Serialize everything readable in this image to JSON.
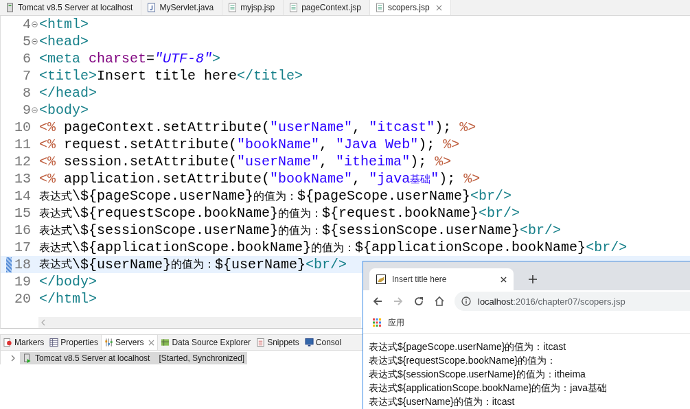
{
  "editor_tabs": [
    {
      "label": "Tomcat v8.5 Server at localhost",
      "kind": "server",
      "selected": false
    },
    {
      "label": "MyServlet.java",
      "kind": "java",
      "selected": false
    },
    {
      "label": "myjsp.jsp",
      "kind": "jsp",
      "selected": false
    },
    {
      "label": "pageContext.jsp",
      "kind": "jsp",
      "selected": false
    },
    {
      "label": "scopers.jsp",
      "kind": "jsp",
      "selected": true
    }
  ],
  "code_lines": [
    {
      "number": "4",
      "folding": true,
      "current": false,
      "tokens": [
        {
          "text": "<html>",
          "kind": "tag"
        }
      ]
    },
    {
      "number": "5",
      "folding": true,
      "current": false,
      "tokens": [
        {
          "text": "<head>",
          "kind": "tag"
        }
      ]
    },
    {
      "number": "6",
      "folding": false,
      "current": false,
      "tokens": [
        {
          "text": "<meta",
          "kind": "tag"
        },
        {
          "text": " charset",
          "kind": "attr"
        },
        {
          "text": "=",
          "kind": "plain"
        },
        {
          "text": "\"UTF-8\"",
          "kind": "value"
        },
        {
          "text": ">",
          "kind": "tag"
        }
      ]
    },
    {
      "number": "7",
      "folding": false,
      "current": false,
      "tokens": [
        {
          "text": "<title>",
          "kind": "tag"
        },
        {
          "text": "Insert title here",
          "kind": "plain"
        },
        {
          "text": "</title>",
          "kind": "tag"
        }
      ]
    },
    {
      "number": "8",
      "folding": false,
      "current": false,
      "tokens": [
        {
          "text": "</head>",
          "kind": "tag"
        }
      ]
    },
    {
      "number": "9",
      "folding": true,
      "current": false,
      "tokens": [
        {
          "text": "<body>",
          "kind": "tag"
        }
      ]
    },
    {
      "number": "10",
      "folding": false,
      "current": false,
      "tokens": [
        {
          "text": "<%",
          "kind": "delim"
        },
        {
          "text": " pageContext.setAttribute(",
          "kind": "plain"
        },
        {
          "text": "\"userName\"",
          "kind": "string"
        },
        {
          "text": ", ",
          "kind": "plain"
        },
        {
          "text": "\"itcast\"",
          "kind": "string"
        },
        {
          "text": "); ",
          "kind": "plain"
        },
        {
          "text": "%>",
          "kind": "delim"
        }
      ]
    },
    {
      "number": "11",
      "folding": false,
      "current": false,
      "tokens": [
        {
          "text": "<%",
          "kind": "delim"
        },
        {
          "text": " request.setAttribute(",
          "kind": "plain"
        },
        {
          "text": "\"bookName\"",
          "kind": "string"
        },
        {
          "text": ", ",
          "kind": "plain"
        },
        {
          "text": "\"Java Web\"",
          "kind": "string"
        },
        {
          "text": "); ",
          "kind": "plain"
        },
        {
          "text": "%>",
          "kind": "delim"
        }
      ]
    },
    {
      "number": "12",
      "folding": false,
      "current": false,
      "tokens": [
        {
          "text": "<%",
          "kind": "delim"
        },
        {
          "text": " session.setAttribute(",
          "kind": "plain"
        },
        {
          "text": "\"userName\"",
          "kind": "string"
        },
        {
          "text": ", ",
          "kind": "plain"
        },
        {
          "text": "\"itheima\"",
          "kind": "string"
        },
        {
          "text": "); ",
          "kind": "plain"
        },
        {
          "text": "%>",
          "kind": "delim"
        }
      ]
    },
    {
      "number": "13",
      "folding": false,
      "current": false,
      "tokens": [
        {
          "text": "<%",
          "kind": "delim"
        },
        {
          "text": " application.setAttribute(",
          "kind": "plain"
        },
        {
          "text": "\"bookName\"",
          "kind": "string"
        },
        {
          "text": ", ",
          "kind": "plain"
        },
        {
          "text": "\"java",
          "kind": "string"
        },
        {
          "text": "基础",
          "kind": "cjkstring"
        },
        {
          "text": "\"",
          "kind": "string"
        },
        {
          "text": "); ",
          "kind": "plain"
        },
        {
          "text": "%>",
          "kind": "delim"
        }
      ]
    },
    {
      "number": "14",
      "folding": false,
      "current": false,
      "tokens": [
        {
          "text": "表达式",
          "kind": "cjk"
        },
        {
          "text": "\\${pageScope.userName}",
          "kind": "plain"
        },
        {
          "text": "的值为：",
          "kind": "cjk"
        },
        {
          "text": "${pageScope.userName}",
          "kind": "plain"
        },
        {
          "text": "<br/>",
          "kind": "tag"
        }
      ]
    },
    {
      "number": "15",
      "folding": false,
      "current": false,
      "tokens": [
        {
          "text": "表达式",
          "kind": "cjk"
        },
        {
          "text": "\\${requestScope.bookName}",
          "kind": "plain"
        },
        {
          "text": "的值为：",
          "kind": "cjk"
        },
        {
          "text": "${request.bookName}",
          "kind": "plain"
        },
        {
          "text": "<br/>",
          "kind": "tag"
        }
      ]
    },
    {
      "number": "16",
      "folding": false,
      "current": false,
      "tokens": [
        {
          "text": "表达式",
          "kind": "cjk"
        },
        {
          "text": "\\${sessionScope.userName}",
          "kind": "plain"
        },
        {
          "text": "的值为：",
          "kind": "cjk"
        },
        {
          "text": "${sessionScope.userName}",
          "kind": "plain"
        },
        {
          "text": "<br/>",
          "kind": "tag"
        }
      ]
    },
    {
      "number": "17",
      "folding": false,
      "current": false,
      "tokens": [
        {
          "text": "表达式",
          "kind": "cjk"
        },
        {
          "text": "\\${applicationScope.bookName}",
          "kind": "plain"
        },
        {
          "text": "的值为：",
          "kind": "cjk"
        },
        {
          "text": "${applicationScope.bookName}",
          "kind": "plain"
        },
        {
          "text": "<br/>",
          "kind": "tag"
        }
      ]
    },
    {
      "number": "18",
      "folding": false,
      "current": true,
      "tokens": [
        {
          "text": "表达式",
          "kind": "cjk"
        },
        {
          "text": "\\${userName}",
          "kind": "plain"
        },
        {
          "text": "的值为：",
          "kind": "cjk"
        },
        {
          "text": "${userName}",
          "kind": "plain"
        },
        {
          "text": "<br/>",
          "kind": "tag"
        }
      ]
    },
    {
      "number": "19",
      "folding": false,
      "current": false,
      "tokens": [
        {
          "text": "</body>",
          "kind": "tag"
        }
      ]
    },
    {
      "number": "20",
      "folding": false,
      "current": false,
      "tokens": [
        {
          "text": "</html>",
          "kind": "tag"
        }
      ]
    }
  ],
  "panel_tabs": [
    {
      "label": "Markers",
      "kind": "markers",
      "selected": false
    },
    {
      "label": "Properties",
      "kind": "properties",
      "selected": false
    },
    {
      "label": "Servers",
      "kind": "servers",
      "selected": true
    },
    {
      "label": "Data Source Explorer",
      "kind": "datasource",
      "selected": false
    },
    {
      "label": "Snippets",
      "kind": "snippets",
      "selected": false
    },
    {
      "label": "Consol",
      "kind": "console",
      "selected": false
    }
  ],
  "servers": [
    {
      "name": "Tomcat v8.5 Server at localhost",
      "status": "[Started, Synchronized]",
      "expanded": false,
      "selected": true
    }
  ],
  "browser": {
    "tab_title": "Insert title here",
    "url_host": "localhost",
    "url_path": ":2016/chapter07/scopers.jsp",
    "bookmark": "应用",
    "content_lines": [
      "表达式${pageScope.userName}的值为：itcast",
      "表达式${requestScope.bookName}的值为：",
      "表达式${sessionScope.userName}的值为：itheima",
      "表达式${applicationScope.bookName}的值为：java基础",
      "表达式${userName}的值为：itcast"
    ]
  }
}
